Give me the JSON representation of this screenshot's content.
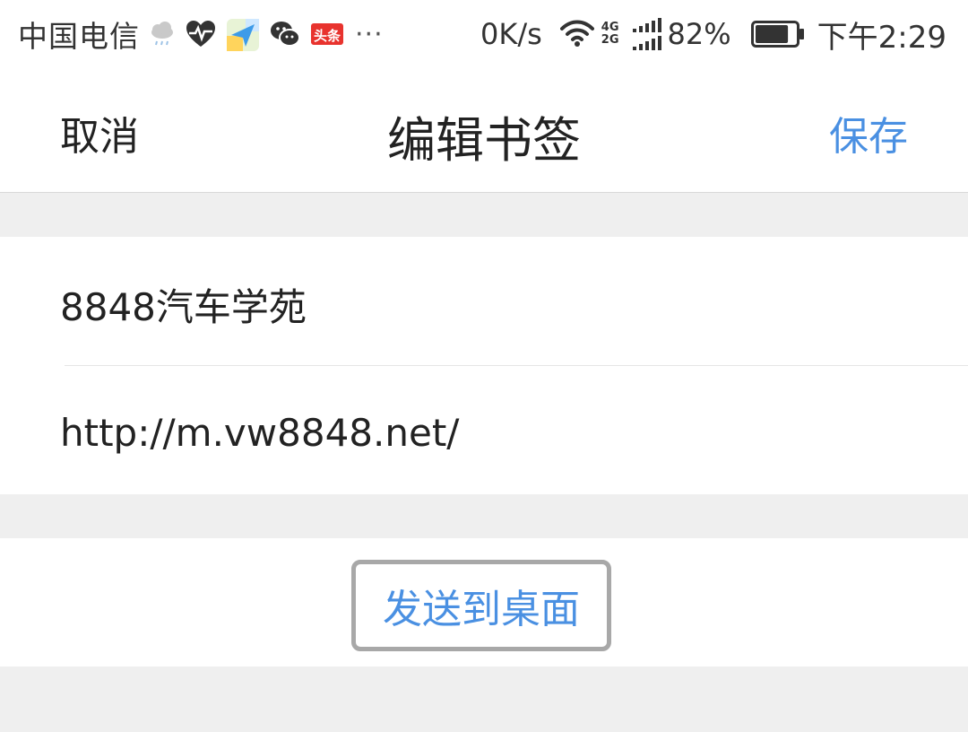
{
  "status_bar": {
    "carrier": "中国电信",
    "notification_icons": [
      "weather-rain-icon",
      "health-heart-icon",
      "maps-icon",
      "wechat-icon",
      "toutiao-icon"
    ],
    "toutiao_label": "头条",
    "more": "···",
    "net_speed": "0K/s",
    "net_type_top": "4G",
    "net_type_bottom": "2G",
    "battery_percent": "82%",
    "battery_level": 0.82,
    "time": "下午2:29"
  },
  "header": {
    "cancel_label": "取消",
    "title": "编辑书签",
    "save_label": "保存"
  },
  "form": {
    "bookmark_title": "8848汽车学苑",
    "bookmark_url": "http://m.vw8848.net/"
  },
  "actions": {
    "send_to_desktop_label": "发送到桌面"
  },
  "colors": {
    "accent": "#4a90e2",
    "background": "#efefef",
    "card": "#ffffff",
    "text": "#222222",
    "focus_border": "#a8a8a8"
  }
}
